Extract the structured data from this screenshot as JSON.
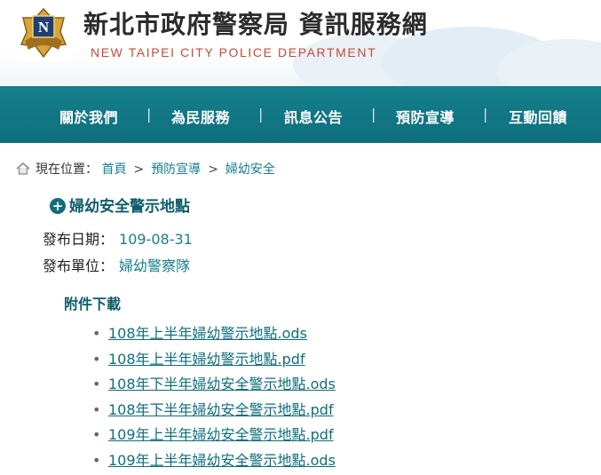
{
  "header": {
    "title": "新北市政府警察局 資訊服務網",
    "subtitle": "NEW TAIPEI CITY POLICE DEPARTMENT",
    "logo_letter": "N",
    "logo_icon": "police-badge-icon"
  },
  "nav": {
    "items": [
      {
        "label": "關於我們"
      },
      {
        "label": "為民服務"
      },
      {
        "label": "訊息公告"
      },
      {
        "label": "預防宣導"
      },
      {
        "label": "互動回饋"
      }
    ],
    "separator": "|"
  },
  "breadcrumb": {
    "icon": "home-icon",
    "label": "現在位置：",
    "items": [
      "首頁",
      "預防宣導",
      "婦幼安全"
    ],
    "arrow": ">"
  },
  "article": {
    "title": "婦幼安全警示地點",
    "title_icon": "plus-circle-icon",
    "date_label": "發布日期：",
    "date_value": "109-08-31",
    "unit_label": "發布單位：",
    "unit_value": "婦幼警察隊"
  },
  "attachments": {
    "heading": "附件下載",
    "bullet": "•",
    "files": [
      "108年上半年婦幼警示地點.ods",
      "108年上半年婦幼警示地點.pdf",
      "108年下半年婦幼安全警示地點.ods",
      "108年下半年婦幼安全警示地點.pdf",
      "109年上半年婦幼安全警示地點.pdf",
      "109年上半年婦幼安全警示地點.ods"
    ]
  },
  "colors": {
    "nav_bg": "#157f8c",
    "link": "#157f8c",
    "heading": "#0f5c69",
    "subtitle": "#c74a36"
  }
}
